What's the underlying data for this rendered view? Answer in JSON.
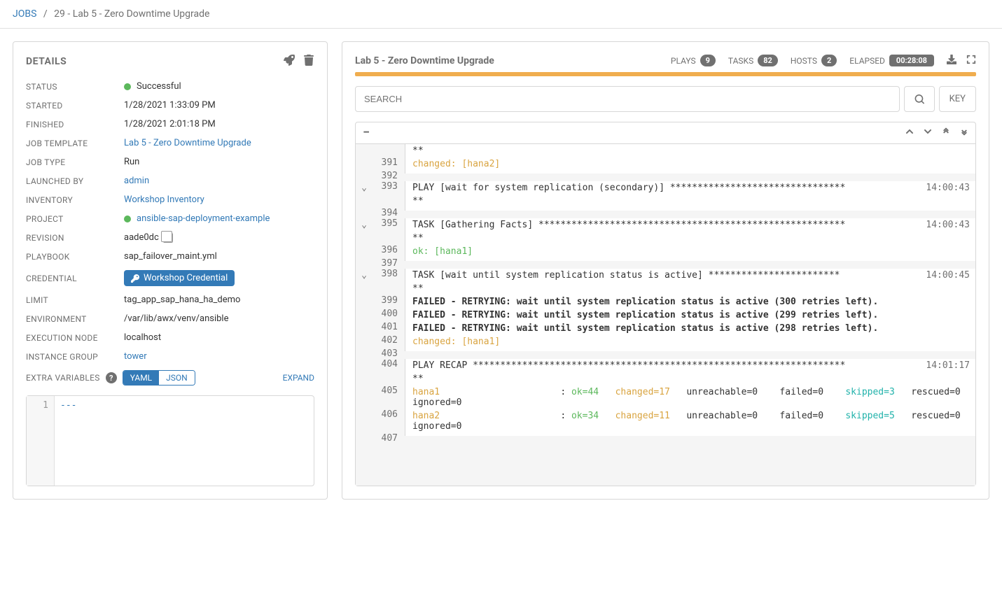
{
  "breadcrumb": {
    "root": "JOBS",
    "current": "29 - Lab 5 - Zero Downtime Upgrade"
  },
  "details": {
    "heading": "DETAILS",
    "labels": {
      "status": "STATUS",
      "started": "STARTED",
      "finished": "FINISHED",
      "job_template": "JOB TEMPLATE",
      "job_type": "JOB TYPE",
      "launched_by": "LAUNCHED BY",
      "inventory": "INVENTORY",
      "project": "PROJECT",
      "revision": "REVISION",
      "playbook": "PLAYBOOK",
      "credential": "CREDENTIAL",
      "limit": "LIMIT",
      "environment": "ENVIRONMENT",
      "execution_node": "EXECUTION NODE",
      "instance_group": "INSTANCE GROUP",
      "extra_vars": "EXTRA VARIABLES"
    },
    "status": "Successful",
    "started": "1/28/2021 1:33:09 PM",
    "finished": "1/28/2021 2:01:18 PM",
    "job_template": "Lab 5 - Zero Downtime Upgrade",
    "job_type": "Run",
    "launched_by": "admin",
    "inventory": "Workshop Inventory",
    "project": "ansible-sap-deployment-example",
    "revision": "aade0dc",
    "playbook": "sap_failover_maint.yml",
    "credential": "Workshop Credential",
    "limit": "tag_app_sap_hana_ha_demo",
    "environment": "/var/lib/awx/venv/ansible",
    "execution_node": "localhost",
    "instance_group": "tower",
    "toggle_yaml": "YAML",
    "toggle_json": "JSON",
    "expand": "EXPAND",
    "code_line": "1",
    "code_content": "---"
  },
  "output": {
    "title": "Lab 5 - Zero Downtime Upgrade",
    "plays_label": "PLAYS",
    "plays": "9",
    "tasks_label": "TASKS",
    "tasks": "82",
    "hosts_label": "HOSTS",
    "hosts": "2",
    "elapsed_label": "ELAPSED",
    "elapsed": "00:28:08",
    "search_placeholder": "SEARCH",
    "key_label": "KEY",
    "lines": [
      {
        "n": "",
        "exp": "",
        "text": "**",
        "time": ""
      },
      {
        "n": "391",
        "exp": "",
        "segs": [
          {
            "t": "changed: [hana2]",
            "c": "c-changed"
          }
        ],
        "time": ""
      },
      {
        "n": "392",
        "exp": "",
        "text": "",
        "time": ""
      },
      {
        "n": "393",
        "exp": "v",
        "text": "PLAY [wait for system replication (secondary)] ********************************",
        "time": "14:00:43"
      },
      {
        "n": "",
        "exp": "",
        "text": "**",
        "time": ""
      },
      {
        "n": "394",
        "exp": "",
        "text": "",
        "time": ""
      },
      {
        "n": "395",
        "exp": "v",
        "text": "TASK [Gathering Facts] ********************************************************",
        "time": "14:00:43"
      },
      {
        "n": "",
        "exp": "",
        "text": "**",
        "time": ""
      },
      {
        "n": "396",
        "exp": "",
        "segs": [
          {
            "t": "ok: [hana1]",
            "c": "c-ok"
          }
        ],
        "time": ""
      },
      {
        "n": "397",
        "exp": "",
        "text": "",
        "time": ""
      },
      {
        "n": "398",
        "exp": "v",
        "text": "TASK [wait until system replication status is active] ************************",
        "time": "14:00:45"
      },
      {
        "n": "",
        "exp": "",
        "text": "**",
        "time": ""
      },
      {
        "n": "399",
        "exp": "",
        "segs": [
          {
            "t": "FAILED - RETRYING: wait until system replication status is active (300 retries left).",
            "c": "c-bold"
          }
        ],
        "time": ""
      },
      {
        "n": "400",
        "exp": "",
        "segs": [
          {
            "t": "FAILED - RETRYING: wait until system replication status is active (299 retries left).",
            "c": "c-bold"
          }
        ],
        "time": ""
      },
      {
        "n": "401",
        "exp": "",
        "segs": [
          {
            "t": "FAILED - RETRYING: wait until system replication status is active (298 retries left).",
            "c": "c-bold"
          }
        ],
        "time": ""
      },
      {
        "n": "402",
        "exp": "",
        "segs": [
          {
            "t": "changed: [hana1]",
            "c": "c-changed"
          }
        ],
        "time": ""
      },
      {
        "n": "403",
        "exp": "",
        "text": "",
        "time": ""
      },
      {
        "n": "404",
        "exp": "",
        "text": "PLAY RECAP ********************************************************************",
        "time": "14:01:17"
      },
      {
        "n": "",
        "exp": "",
        "text": "**",
        "time": ""
      },
      {
        "n": "405",
        "exp": "",
        "segs": [
          {
            "t": "hana1                      ",
            "c": "c-changed"
          },
          {
            "t": ": ",
            "c": ""
          },
          {
            "t": "ok=44   ",
            "c": "c-ok"
          },
          {
            "t": "changed=17   ",
            "c": "c-changed"
          },
          {
            "t": "unreachable=0    failed=0    ",
            "c": ""
          },
          {
            "t": "skipped=3   ",
            "c": "c-skip"
          },
          {
            "t": "rescued=0    ignored=0",
            "c": ""
          }
        ],
        "time": ""
      },
      {
        "n": "406",
        "exp": "",
        "segs": [
          {
            "t": "hana2                      ",
            "c": "c-changed"
          },
          {
            "t": ": ",
            "c": ""
          },
          {
            "t": "ok=34   ",
            "c": "c-ok"
          },
          {
            "t": "changed=11   ",
            "c": "c-changed"
          },
          {
            "t": "unreachable=0    failed=0    ",
            "c": ""
          },
          {
            "t": "skipped=5   ",
            "c": "c-skip"
          },
          {
            "t": "rescued=0    ignored=0",
            "c": ""
          }
        ],
        "time": ""
      },
      {
        "n": "407",
        "exp": "",
        "text": "",
        "time": ""
      }
    ]
  }
}
